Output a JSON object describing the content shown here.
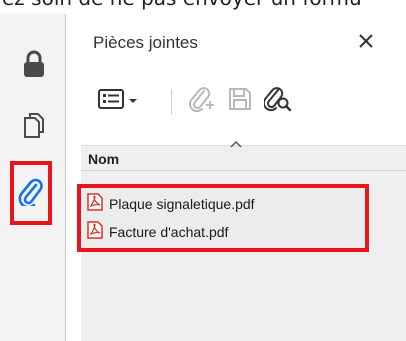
{
  "top_text": "ez soin de ne pas envoyer un formu",
  "rail": {
    "items": [
      {
        "icon": "lock-icon"
      },
      {
        "icon": "pages-icon"
      },
      {
        "icon": "paperclip-icon",
        "highlighted": true
      }
    ]
  },
  "panel": {
    "title": "Pièces jointes",
    "close_icon": "close-icon",
    "column_header": "Nom"
  },
  "files": [
    {
      "name": "Plaque signaletique.pdf",
      "icon": "pdf-file-icon"
    },
    {
      "name": "Facture d'achat.pdf",
      "icon": "pdf-file-icon"
    }
  ],
  "colors": {
    "highlight": "#e8161b",
    "icon_blue": "#1473e6",
    "icon_gray": "#4a4a4a",
    "pdf_red": "#d93025"
  }
}
